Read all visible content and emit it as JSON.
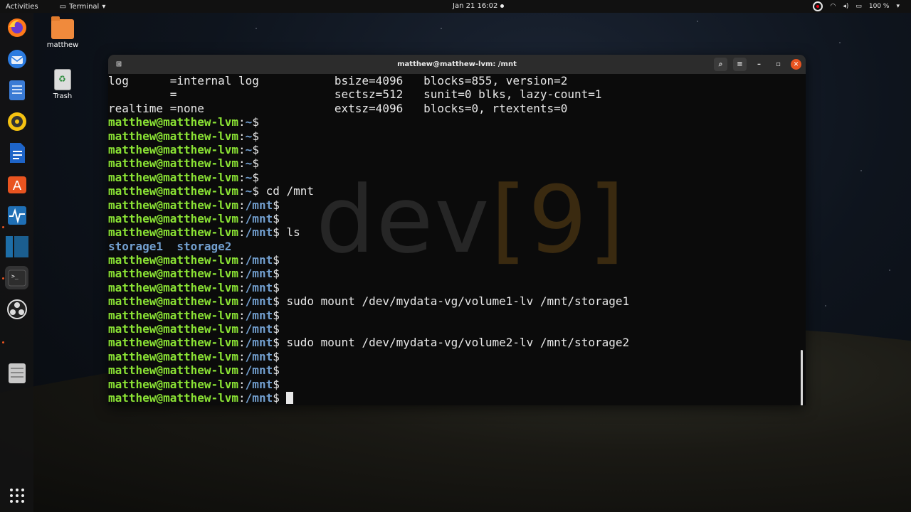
{
  "topbar": {
    "activities": "Activities",
    "app_menu": "Terminal",
    "clock": "Jan 21  16:02",
    "battery": "100 %"
  },
  "desktop": {
    "home_label": "matthew",
    "trash_label": "Trash"
  },
  "dock": {
    "items": [
      "firefox-icon",
      "thunderbird-icon",
      "files-icon",
      "rhythmbox-icon",
      "writer-icon",
      "software-icon",
      "monitor-icon",
      "app-icon",
      "terminal-icon",
      "obs-icon",
      "storage-icon"
    ]
  },
  "window": {
    "title": "matthew@matthew-lvm: /mnt"
  },
  "terminal": {
    "watermark_text": "dev",
    "watermark_open": "[",
    "watermark_num": "9",
    "watermark_close": "]",
    "prompt_user": "matthew@matthew-lvm",
    "lines": [
      {
        "kind": "text",
        "text": "log      =internal log           bsize=4096   blocks=855, version=2"
      },
      {
        "kind": "text",
        "text": "         =                       sectsz=512   sunit=0 blks, lazy-count=1"
      },
      {
        "kind": "text",
        "text": "realtime =none                   extsz=4096   blocks=0, rtextents=0"
      },
      {
        "kind": "prompt",
        "path": "~",
        "cmd": ""
      },
      {
        "kind": "prompt",
        "path": "~",
        "cmd": ""
      },
      {
        "kind": "prompt",
        "path": "~",
        "cmd": ""
      },
      {
        "kind": "prompt",
        "path": "~",
        "cmd": ""
      },
      {
        "kind": "prompt",
        "path": "~",
        "cmd": ""
      },
      {
        "kind": "prompt",
        "path": "~",
        "cmd": " cd /mnt"
      },
      {
        "kind": "prompt",
        "path": "/mnt",
        "cmd": ""
      },
      {
        "kind": "prompt",
        "path": "/mnt",
        "cmd": ""
      },
      {
        "kind": "prompt",
        "path": "/mnt",
        "cmd": " ls"
      },
      {
        "kind": "dirs",
        "text": "storage1  storage2"
      },
      {
        "kind": "prompt",
        "path": "/mnt",
        "cmd": ""
      },
      {
        "kind": "prompt",
        "path": "/mnt",
        "cmd": ""
      },
      {
        "kind": "prompt",
        "path": "/mnt",
        "cmd": ""
      },
      {
        "kind": "prompt",
        "path": "/mnt",
        "cmd": " sudo mount /dev/mydata-vg/volume1-lv /mnt/storage1"
      },
      {
        "kind": "prompt",
        "path": "/mnt",
        "cmd": ""
      },
      {
        "kind": "prompt",
        "path": "/mnt",
        "cmd": ""
      },
      {
        "kind": "prompt",
        "path": "/mnt",
        "cmd": " sudo mount /dev/mydata-vg/volume2-lv /mnt/storage2"
      },
      {
        "kind": "prompt",
        "path": "/mnt",
        "cmd": ""
      },
      {
        "kind": "prompt",
        "path": "/mnt",
        "cmd": ""
      },
      {
        "kind": "prompt",
        "path": "/mnt",
        "cmd": ""
      },
      {
        "kind": "prompt",
        "path": "/mnt",
        "cmd": " ",
        "cursor": true
      }
    ]
  }
}
